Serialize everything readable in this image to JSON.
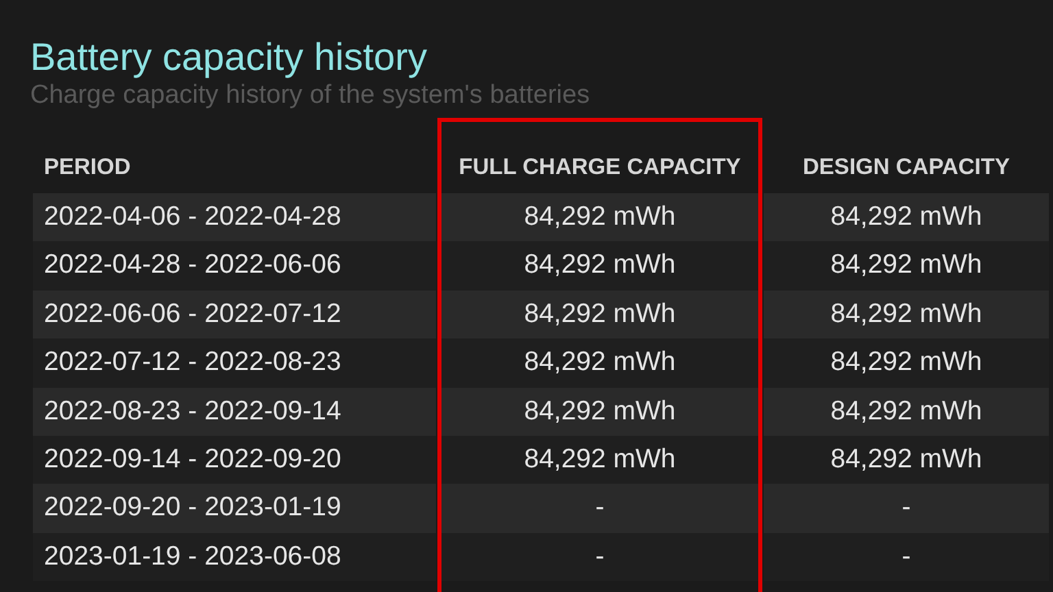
{
  "title": "Battery capacity history",
  "subtitle": "Charge capacity history of the system's batteries",
  "table": {
    "columns": [
      {
        "label": "PERIOD",
        "highlighted": false
      },
      {
        "label": "FULL CHARGE CAPACITY",
        "highlighted": true
      },
      {
        "label": "DESIGN CAPACITY",
        "highlighted": false
      }
    ],
    "rows": [
      [
        "2022-04-06 - 2022-04-28",
        "84,292 mWh",
        "84,292 mWh"
      ],
      [
        "2022-04-28 - 2022-06-06",
        "84,292 mWh",
        "84,292 mWh"
      ],
      [
        "2022-06-06 - 2022-07-12",
        "84,292 mWh",
        "84,292 mWh"
      ],
      [
        "2022-07-12 - 2022-08-23",
        "84,292 mWh",
        "84,292 mWh"
      ],
      [
        "2022-08-23 - 2022-09-14",
        "84,292 mWh",
        "84,292 mWh"
      ],
      [
        "2022-09-14 - 2022-09-20",
        "84,292 mWh",
        "84,292 mWh"
      ],
      [
        "2022-09-20 - 2023-01-19",
        "-",
        "-"
      ],
      [
        "2023-01-19 - 2023-06-08",
        "-",
        "-"
      ]
    ]
  }
}
